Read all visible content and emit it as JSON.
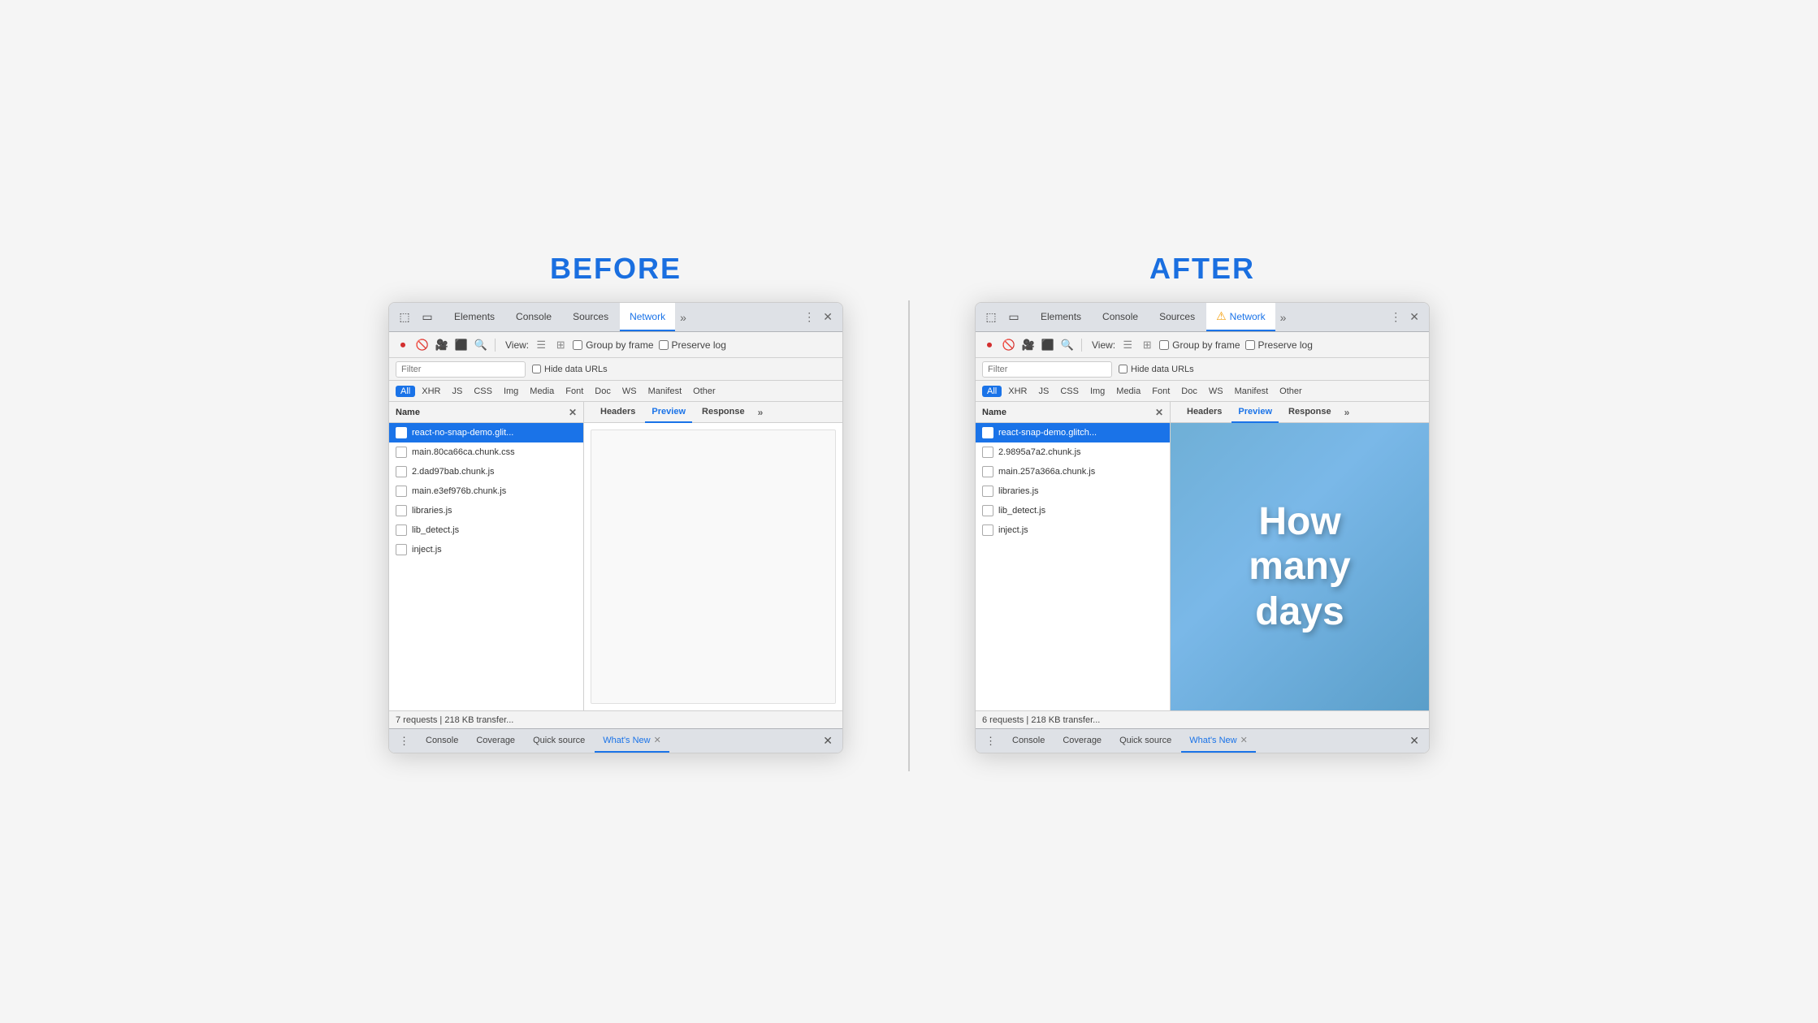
{
  "before": {
    "label": "BEFORE",
    "tabs": [
      "Elements",
      "Console",
      "Sources",
      "Network",
      ">>"
    ],
    "active_tab": "Network",
    "toolbar": {
      "view_label": "View:",
      "group_by_frame": "Group by frame",
      "preserve_log": "Preserve log"
    },
    "filter": {
      "placeholder": "Filter",
      "hide_data_urls": "Hide data URLs"
    },
    "type_filters": [
      "All",
      "XHR",
      "JS",
      "CSS",
      "Img",
      "Media",
      "Font",
      "Doc",
      "WS",
      "Manifest",
      "Other"
    ],
    "active_type": "All",
    "columns": {
      "name": "Name",
      "detail_tabs": [
        "Headers",
        "Preview",
        "Response",
        ">>"
      ],
      "active_detail": "Preview"
    },
    "files": [
      {
        "name": "react-no-snap-demo.glit...",
        "selected": true
      },
      {
        "name": "main.80ca66ca.chunk.css",
        "selected": false
      },
      {
        "name": "2.dad97bab.chunk.js",
        "selected": false
      },
      {
        "name": "main.e3ef976b.chunk.js",
        "selected": false
      },
      {
        "name": "libraries.js",
        "selected": false
      },
      {
        "name": "lib_detect.js",
        "selected": false
      },
      {
        "name": "inject.js",
        "selected": false
      }
    ],
    "status": "7 requests | 218 KB transfer...",
    "bottom_tabs": [
      "Console",
      "Coverage",
      "Quick source",
      "What's New"
    ],
    "active_bottom_tab": "What's New",
    "preview_empty": true
  },
  "after": {
    "label": "AFTER",
    "tabs": [
      "Elements",
      "Console",
      "Sources",
      "Network",
      ">>"
    ],
    "active_tab": "Network",
    "has_warning": true,
    "toolbar": {
      "view_label": "View:",
      "group_by_frame": "Group by frame",
      "preserve_log": "Preserve log"
    },
    "filter": {
      "placeholder": "Filter",
      "hide_data_urls": "Hide data URLs"
    },
    "type_filters": [
      "All",
      "XHR",
      "JS",
      "CSS",
      "Img",
      "Media",
      "Font",
      "Doc",
      "WS",
      "Manifest",
      "Other"
    ],
    "active_type": "All",
    "columns": {
      "name": "Name",
      "detail_tabs": [
        "Headers",
        "Preview",
        "Response",
        ">>"
      ],
      "active_detail": "Preview"
    },
    "files": [
      {
        "name": "react-snap-demo.glitch...",
        "selected": true
      },
      {
        "name": "2.9895a7a2.chunk.js",
        "selected": false
      },
      {
        "name": "main.257a366a.chunk.js",
        "selected": false
      },
      {
        "name": "libraries.js",
        "selected": false
      },
      {
        "name": "lib_detect.js",
        "selected": false
      },
      {
        "name": "inject.js",
        "selected": false
      }
    ],
    "status": "6 requests | 218 KB transfer...",
    "bottom_tabs": [
      "Console",
      "Coverage",
      "Quick source",
      "What's New"
    ],
    "active_bottom_tab": "What's New",
    "preview_text": "How\nmany\ndays",
    "preview_empty": false
  },
  "divider_color": "#cccccc"
}
